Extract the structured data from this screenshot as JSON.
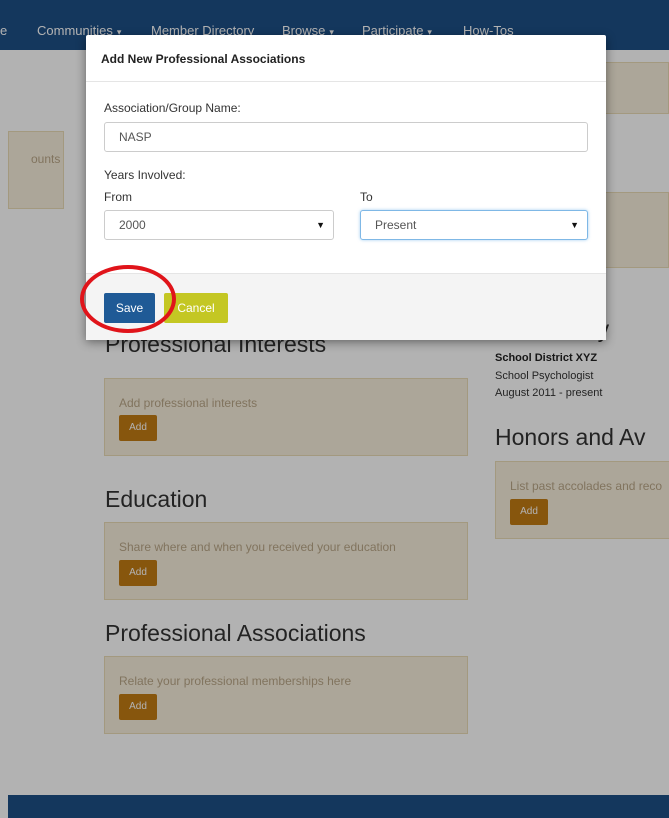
{
  "nav": {
    "items": [
      {
        "label": "e",
        "caret": false
      },
      {
        "label": "Communities",
        "caret": true
      },
      {
        "label": "Member Directory",
        "caret": false
      },
      {
        "label": "Browse",
        "caret": true
      },
      {
        "label": "Participate",
        "caret": true
      },
      {
        "label": "How-Tos",
        "caret": false
      }
    ],
    "caret_glyph": "▾"
  },
  "left_card": {
    "text": "ounts"
  },
  "sections": {
    "professional_interests": {
      "title": "Professional Interests",
      "prompt": "Add professional interests",
      "add_label": "Add"
    },
    "education": {
      "title": "Education",
      "prompt": "Share where and when you received your education",
      "add_label": "Add"
    },
    "professional_associations": {
      "title": "Professional Associations",
      "prompt": "Relate your professional memberships here",
      "add_label": "Add"
    }
  },
  "right_column": {
    "history_title_partial": "ry",
    "employer": "School District XYZ",
    "role": "School Psychologist",
    "dates": "August 2011 - present",
    "honors_title": "Honors and Av",
    "honors_prompt": "List past accolades and reco",
    "add_label": "Add"
  },
  "modal": {
    "title": "Add New Professional Associations",
    "name_label": "Association/Group Name:",
    "name_value": "NASP",
    "years_label": "Years Involved:",
    "from_label": "From",
    "from_value": "2000",
    "to_label": "To",
    "to_value": "Present",
    "save_label": "Save",
    "cancel_label": "Cancel",
    "select_caret": "▼"
  },
  "colors": {
    "navbar": "#1e4f86",
    "save": "#1f5a96",
    "cancel": "#c4c723",
    "add": "#c27b14",
    "annotation": "#e0141a"
  }
}
